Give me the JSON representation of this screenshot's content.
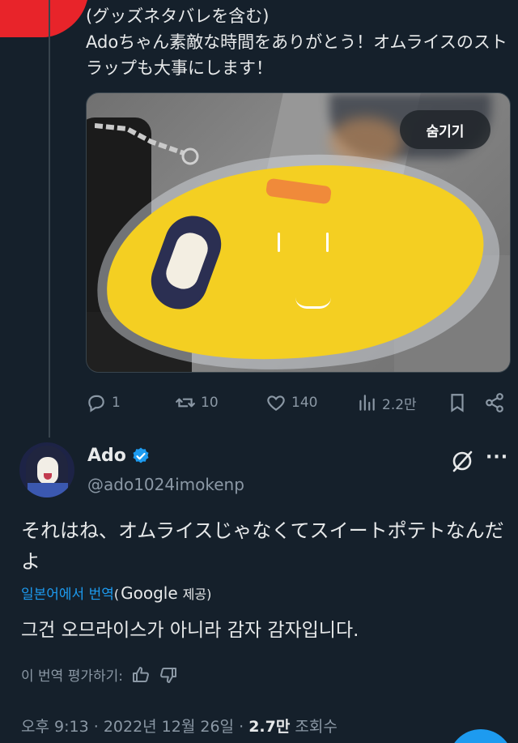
{
  "parent_tweet": {
    "spoiler_note": "(グッズネタバレを含む)",
    "text": "Adoちゃん素敵な時間をありがとう！オムライスのストラップも大事にします！",
    "media_hide_label": "숨기기",
    "actions": {
      "reply_count": "1",
      "retweet_count": "10",
      "like_count": "140",
      "view_count": "2.2만"
    }
  },
  "reply_tweet": {
    "display_name": "Ado",
    "handle": "@ado1024imokenp",
    "text": "それはね、オムライスじゃなくてスイートポテトなんだよ",
    "translate_label": "일본어에서 번역",
    "translate_paren_open": "(",
    "translate_brand": "Google",
    "translate_by": "제공)",
    "translated_text": "그건 오므라이스가 아니라 감자 감자입니다.",
    "rate_label": "이 번역 평가하기:",
    "time": "오후 9:13",
    "sep1": "·",
    "date": "2022년 12월 26일",
    "sep2": "·",
    "views_count": "2.7만",
    "views_label": "조회수"
  },
  "colors": {
    "background": "#15202b",
    "accent": "#1d9bf0",
    "muted": "#8b98a5",
    "charm_yellow": "#f4cf22"
  },
  "icons": [
    "reply-icon",
    "retweet-icon",
    "like-icon",
    "views-icon",
    "bookmark-icon",
    "share-icon",
    "verified-badge-icon",
    "grok-icon",
    "more-icon",
    "thumbs-up-icon",
    "thumbs-down-icon"
  ]
}
